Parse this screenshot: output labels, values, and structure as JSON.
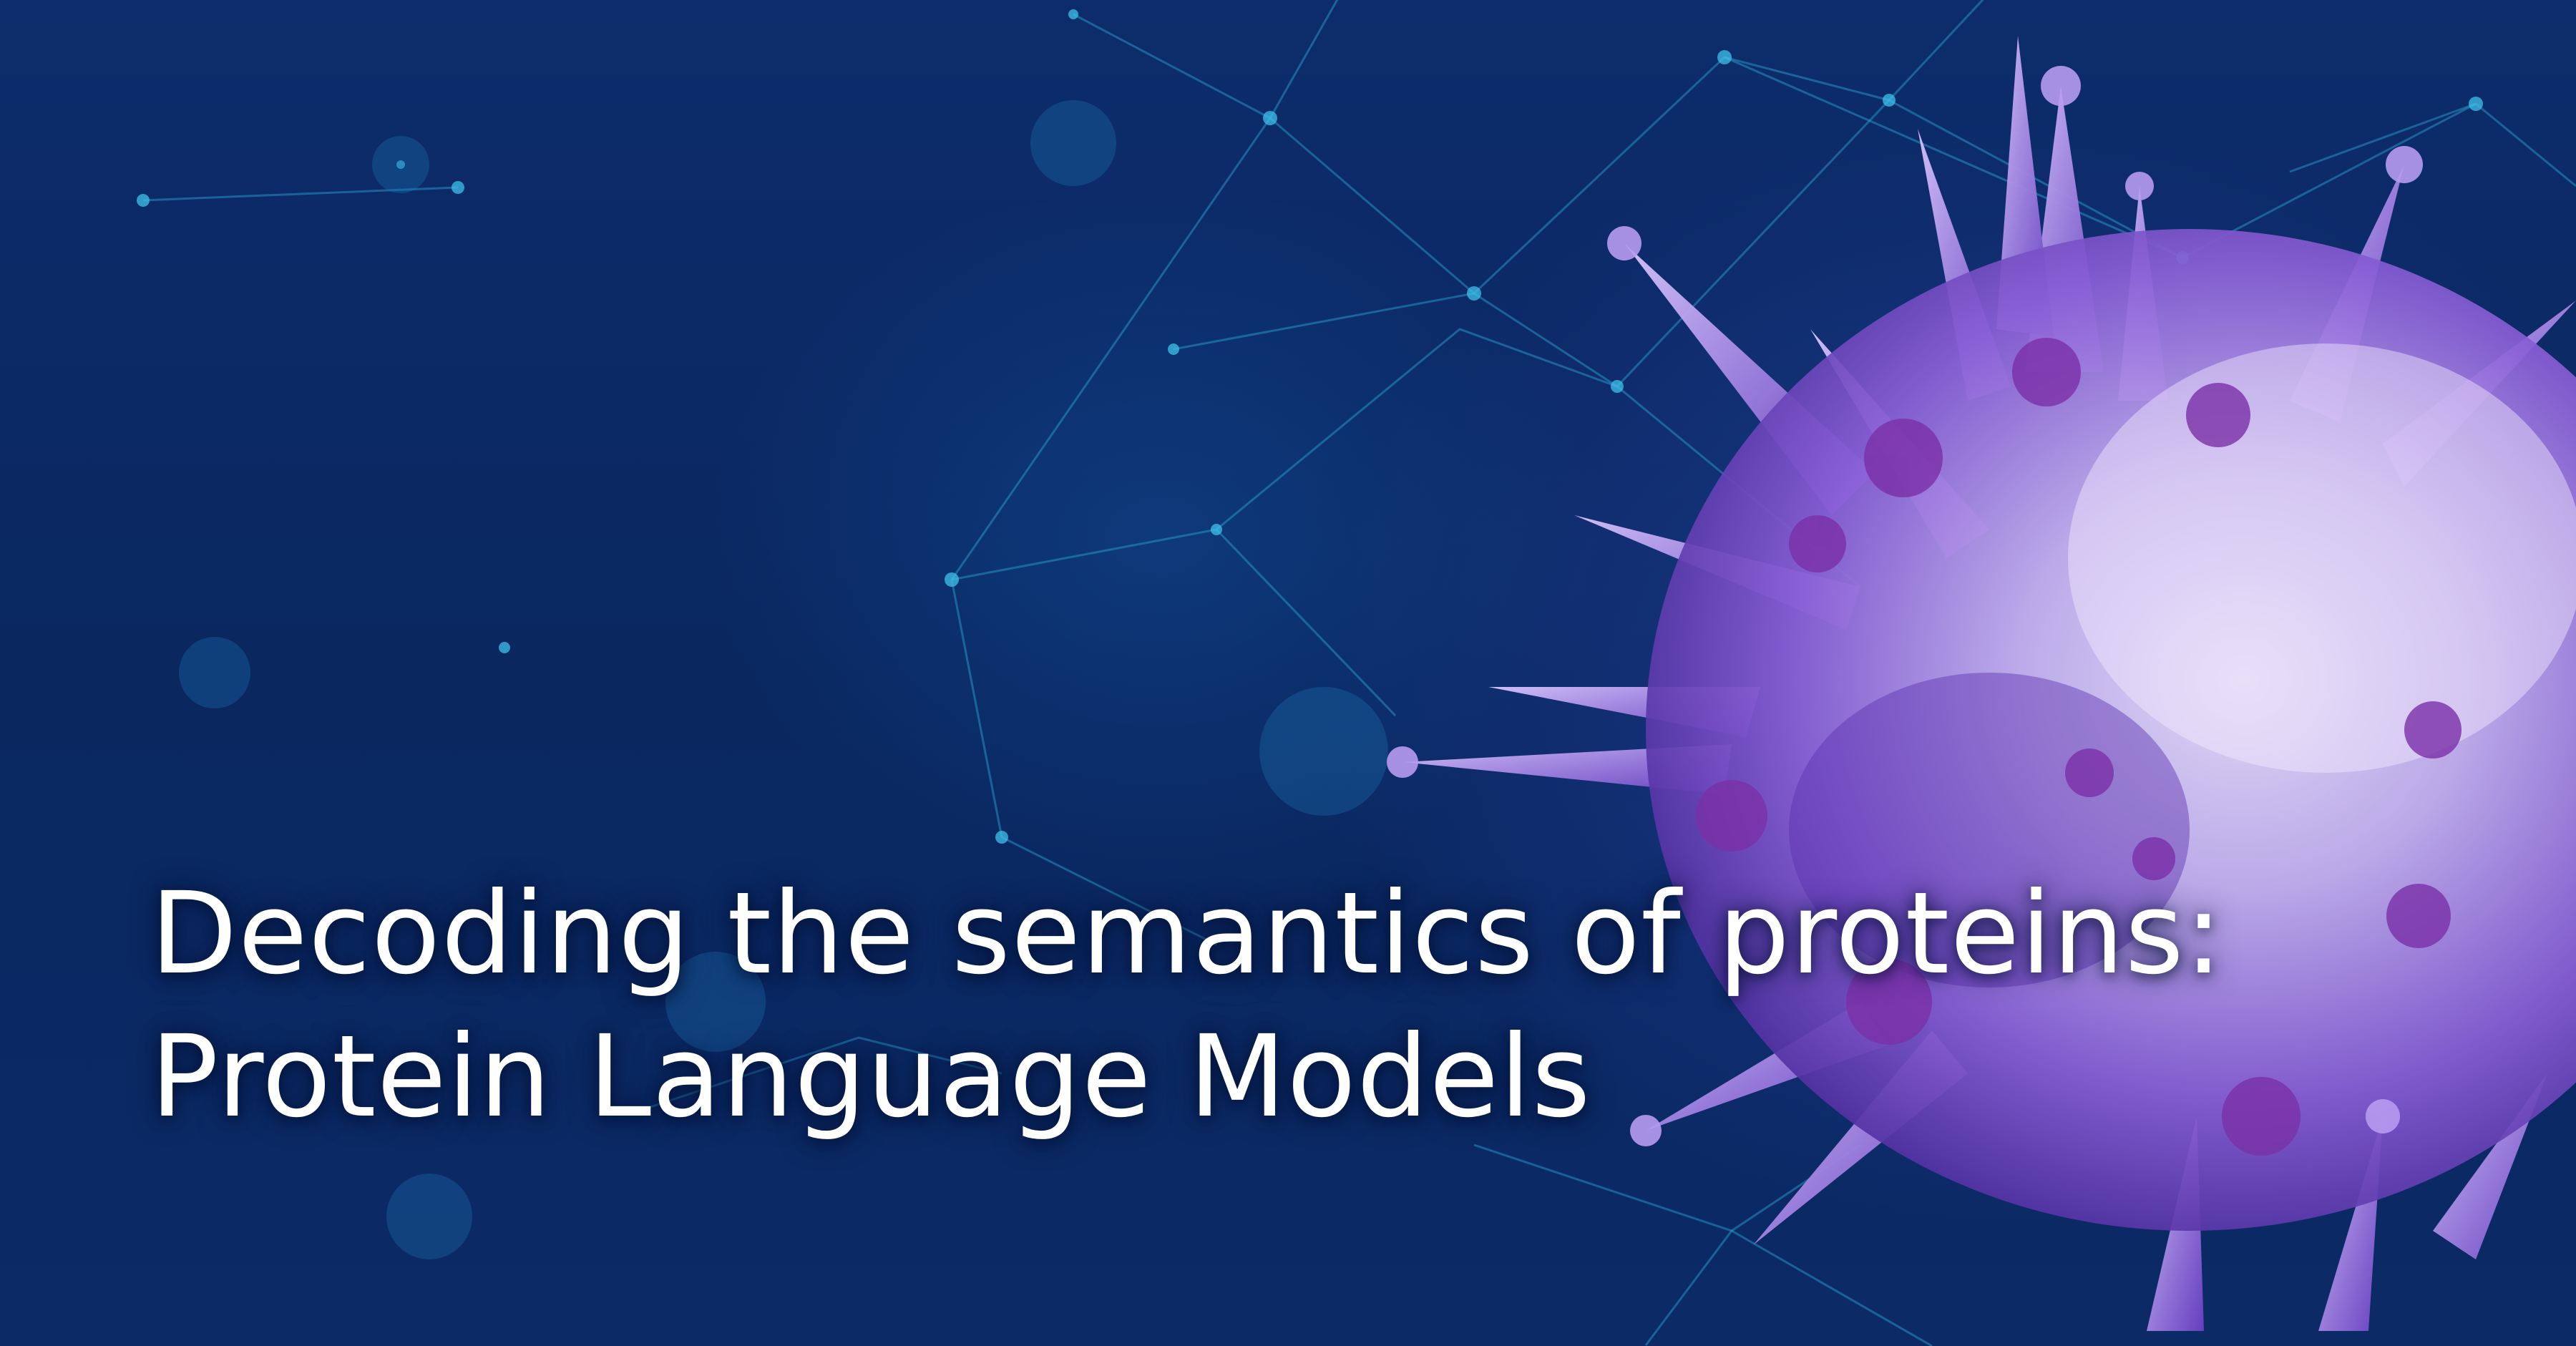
{
  "headline": {
    "line1": "Decoding the semantics of proteins:",
    "line2": "Protein Language Models"
  },
  "colors": {
    "background": "#0b2a66",
    "network": "#2aa8d8",
    "protein_light": "#c9b3f2",
    "protein_mid": "#8a5fd6",
    "protein_dark": "#4a2a9a",
    "text": "#ffffff"
  },
  "scene": {
    "subject": "protein-molecule-illustration",
    "backdrop": "network-connection-lines"
  }
}
